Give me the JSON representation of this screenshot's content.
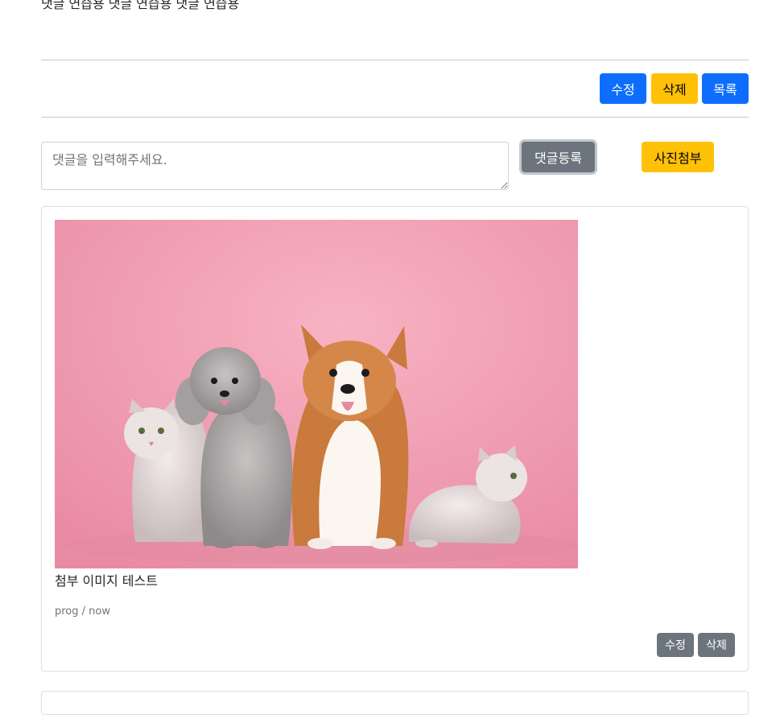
{
  "post": {
    "body": "댓글 연습용 댓글 연습용 댓글 연습용"
  },
  "post_actions": {
    "edit_label": "수정",
    "delete_label": "삭제",
    "list_label": "목록"
  },
  "comment_form": {
    "placeholder": "댓글을 입력해주세요.",
    "submit_label": "댓글등록",
    "attach_label": "사진첨부"
  },
  "comments": [
    {
      "image_alt": "pets",
      "text": "첨부 이미지 테스트",
      "author": "prog",
      "time": "now",
      "meta": "prog / now",
      "edit_label": "수정",
      "delete_label": "삭제"
    }
  ],
  "colors": {
    "primary": "#0d6efd",
    "warning": "#ffc107",
    "secondary": "#6c757d",
    "photo_background": "#f4a7b9"
  }
}
